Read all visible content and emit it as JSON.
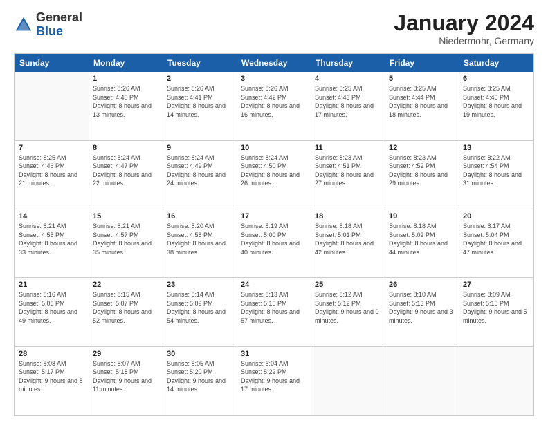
{
  "header": {
    "logo_general": "General",
    "logo_blue": "Blue",
    "month_title": "January 2024",
    "location": "Niedermohr, Germany"
  },
  "weekdays": [
    "Sunday",
    "Monday",
    "Tuesday",
    "Wednesday",
    "Thursday",
    "Friday",
    "Saturday"
  ],
  "weeks": [
    [
      {
        "day": "",
        "sunrise": "",
        "sunset": "",
        "daylight": ""
      },
      {
        "day": "1",
        "sunrise": "Sunrise: 8:26 AM",
        "sunset": "Sunset: 4:40 PM",
        "daylight": "Daylight: 8 hours and 13 minutes."
      },
      {
        "day": "2",
        "sunrise": "Sunrise: 8:26 AM",
        "sunset": "Sunset: 4:41 PM",
        "daylight": "Daylight: 8 hours and 14 minutes."
      },
      {
        "day": "3",
        "sunrise": "Sunrise: 8:26 AM",
        "sunset": "Sunset: 4:42 PM",
        "daylight": "Daylight: 8 hours and 16 minutes."
      },
      {
        "day": "4",
        "sunrise": "Sunrise: 8:25 AM",
        "sunset": "Sunset: 4:43 PM",
        "daylight": "Daylight: 8 hours and 17 minutes."
      },
      {
        "day": "5",
        "sunrise": "Sunrise: 8:25 AM",
        "sunset": "Sunset: 4:44 PM",
        "daylight": "Daylight: 8 hours and 18 minutes."
      },
      {
        "day": "6",
        "sunrise": "Sunrise: 8:25 AM",
        "sunset": "Sunset: 4:45 PM",
        "daylight": "Daylight: 8 hours and 19 minutes."
      }
    ],
    [
      {
        "day": "7",
        "sunrise": "Sunrise: 8:25 AM",
        "sunset": "Sunset: 4:46 PM",
        "daylight": "Daylight: 8 hours and 21 minutes."
      },
      {
        "day": "8",
        "sunrise": "Sunrise: 8:24 AM",
        "sunset": "Sunset: 4:47 PM",
        "daylight": "Daylight: 8 hours and 22 minutes."
      },
      {
        "day": "9",
        "sunrise": "Sunrise: 8:24 AM",
        "sunset": "Sunset: 4:49 PM",
        "daylight": "Daylight: 8 hours and 24 minutes."
      },
      {
        "day": "10",
        "sunrise": "Sunrise: 8:24 AM",
        "sunset": "Sunset: 4:50 PM",
        "daylight": "Daylight: 8 hours and 26 minutes."
      },
      {
        "day": "11",
        "sunrise": "Sunrise: 8:23 AM",
        "sunset": "Sunset: 4:51 PM",
        "daylight": "Daylight: 8 hours and 27 minutes."
      },
      {
        "day": "12",
        "sunrise": "Sunrise: 8:23 AM",
        "sunset": "Sunset: 4:52 PM",
        "daylight": "Daylight: 8 hours and 29 minutes."
      },
      {
        "day": "13",
        "sunrise": "Sunrise: 8:22 AM",
        "sunset": "Sunset: 4:54 PM",
        "daylight": "Daylight: 8 hours and 31 minutes."
      }
    ],
    [
      {
        "day": "14",
        "sunrise": "Sunrise: 8:21 AM",
        "sunset": "Sunset: 4:55 PM",
        "daylight": "Daylight: 8 hours and 33 minutes."
      },
      {
        "day": "15",
        "sunrise": "Sunrise: 8:21 AM",
        "sunset": "Sunset: 4:57 PM",
        "daylight": "Daylight: 8 hours and 35 minutes."
      },
      {
        "day": "16",
        "sunrise": "Sunrise: 8:20 AM",
        "sunset": "Sunset: 4:58 PM",
        "daylight": "Daylight: 8 hours and 38 minutes."
      },
      {
        "day": "17",
        "sunrise": "Sunrise: 8:19 AM",
        "sunset": "Sunset: 5:00 PM",
        "daylight": "Daylight: 8 hours and 40 minutes."
      },
      {
        "day": "18",
        "sunrise": "Sunrise: 8:18 AM",
        "sunset": "Sunset: 5:01 PM",
        "daylight": "Daylight: 8 hours and 42 minutes."
      },
      {
        "day": "19",
        "sunrise": "Sunrise: 8:18 AM",
        "sunset": "Sunset: 5:02 PM",
        "daylight": "Daylight: 8 hours and 44 minutes."
      },
      {
        "day": "20",
        "sunrise": "Sunrise: 8:17 AM",
        "sunset": "Sunset: 5:04 PM",
        "daylight": "Daylight: 8 hours and 47 minutes."
      }
    ],
    [
      {
        "day": "21",
        "sunrise": "Sunrise: 8:16 AM",
        "sunset": "Sunset: 5:06 PM",
        "daylight": "Daylight: 8 hours and 49 minutes."
      },
      {
        "day": "22",
        "sunrise": "Sunrise: 8:15 AM",
        "sunset": "Sunset: 5:07 PM",
        "daylight": "Daylight: 8 hours and 52 minutes."
      },
      {
        "day": "23",
        "sunrise": "Sunrise: 8:14 AM",
        "sunset": "Sunset: 5:09 PM",
        "daylight": "Daylight: 8 hours and 54 minutes."
      },
      {
        "day": "24",
        "sunrise": "Sunrise: 8:13 AM",
        "sunset": "Sunset: 5:10 PM",
        "daylight": "Daylight: 8 hours and 57 minutes."
      },
      {
        "day": "25",
        "sunrise": "Sunrise: 8:12 AM",
        "sunset": "Sunset: 5:12 PM",
        "daylight": "Daylight: 9 hours and 0 minutes."
      },
      {
        "day": "26",
        "sunrise": "Sunrise: 8:10 AM",
        "sunset": "Sunset: 5:13 PM",
        "daylight": "Daylight: 9 hours and 3 minutes."
      },
      {
        "day": "27",
        "sunrise": "Sunrise: 8:09 AM",
        "sunset": "Sunset: 5:15 PM",
        "daylight": "Daylight: 9 hours and 5 minutes."
      }
    ],
    [
      {
        "day": "28",
        "sunrise": "Sunrise: 8:08 AM",
        "sunset": "Sunset: 5:17 PM",
        "daylight": "Daylight: 9 hours and 8 minutes."
      },
      {
        "day": "29",
        "sunrise": "Sunrise: 8:07 AM",
        "sunset": "Sunset: 5:18 PM",
        "daylight": "Daylight: 9 hours and 11 minutes."
      },
      {
        "day": "30",
        "sunrise": "Sunrise: 8:05 AM",
        "sunset": "Sunset: 5:20 PM",
        "daylight": "Daylight: 9 hours and 14 minutes."
      },
      {
        "day": "31",
        "sunrise": "Sunrise: 8:04 AM",
        "sunset": "Sunset: 5:22 PM",
        "daylight": "Daylight: 9 hours and 17 minutes."
      },
      {
        "day": "",
        "sunrise": "",
        "sunset": "",
        "daylight": ""
      },
      {
        "day": "",
        "sunrise": "",
        "sunset": "",
        "daylight": ""
      },
      {
        "day": "",
        "sunrise": "",
        "sunset": "",
        "daylight": ""
      }
    ]
  ]
}
